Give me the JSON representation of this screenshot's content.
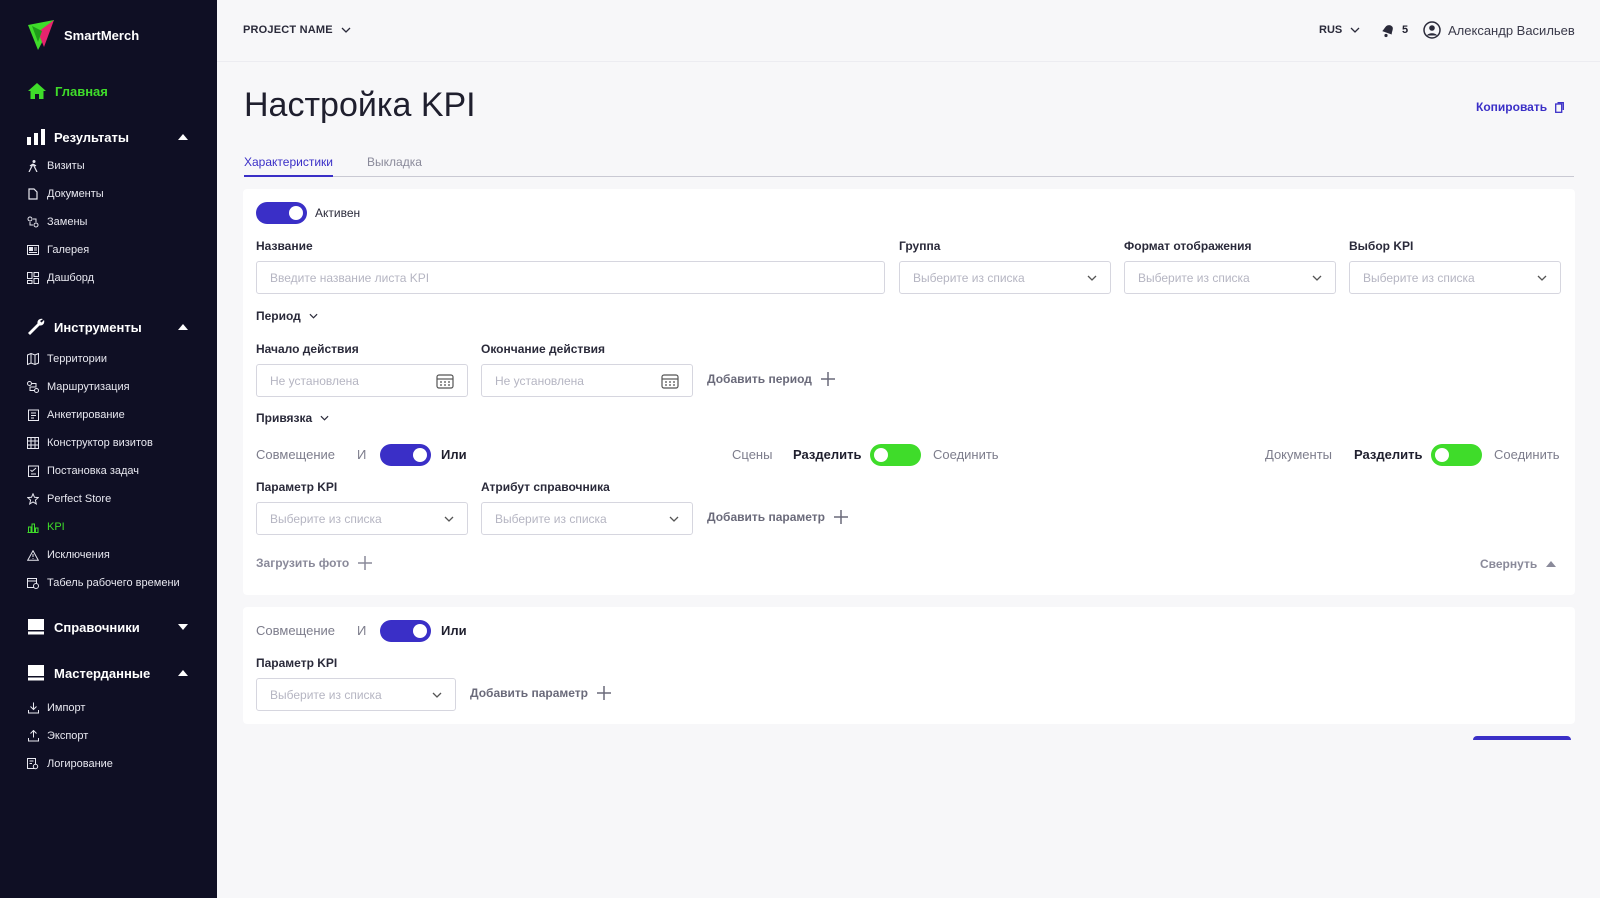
{
  "app": {
    "name": "SmartMerch"
  },
  "sidebar": {
    "home": "Главная",
    "sections": [
      {
        "label": "Результаты",
        "items": [
          "Визиты",
          "Документы",
          "Замены",
          "Галерея",
          "Дашборд"
        ]
      },
      {
        "label": "Инструменты",
        "items": [
          "Территории",
          "Маршрутизация",
          "Анкетирование",
          "Конструктор визитов",
          "Постановка задач",
          "Perfect Store",
          "KPI",
          "Исключения",
          "Табель рабочего времени"
        ]
      },
      {
        "label": "Справочники",
        "items": []
      },
      {
        "label": "Мастерданные",
        "items": [
          "Импорт",
          "Экспорт",
          "Логирование"
        ]
      }
    ]
  },
  "topbar": {
    "project": "PROJECT NAME",
    "lang": "RUS",
    "notifications": "5",
    "user": "Александр Васильев"
  },
  "page": {
    "title": "Настройка KPI",
    "copy": "Копировать"
  },
  "tabs": [
    "Характеристики",
    "Выкладка"
  ],
  "form": {
    "active_label": "Активен",
    "name_label": "Название",
    "name_placeholder": "Введите название листа KPI",
    "group_label": "Группа",
    "format_label": "Формат отображения",
    "kpi_label": "Выбор KPI",
    "select_placeholder": "Выберите из списка",
    "period_label": "Период",
    "start_label": "Начало действия",
    "end_label": "Окончание действия",
    "date_placeholder": "Не установлена",
    "add_period": "Добавить период",
    "binding_label": "Привязка",
    "combine": "Совмещение",
    "and": "И",
    "or": "Или",
    "scenes": "Сцены",
    "docs": "Документы",
    "split": "Разделить",
    "join": "Соединить",
    "param_label": "Параметр KPI",
    "attr_label": "Атрибут справочника",
    "add_param": "Добавить параметр",
    "upload_photo": "Загрузить фото",
    "collapse": "Свернуть"
  },
  "colors": {
    "sidebar": "#0f0f24",
    "accent": "#3a2fc7",
    "green": "#3fdc2a"
  }
}
